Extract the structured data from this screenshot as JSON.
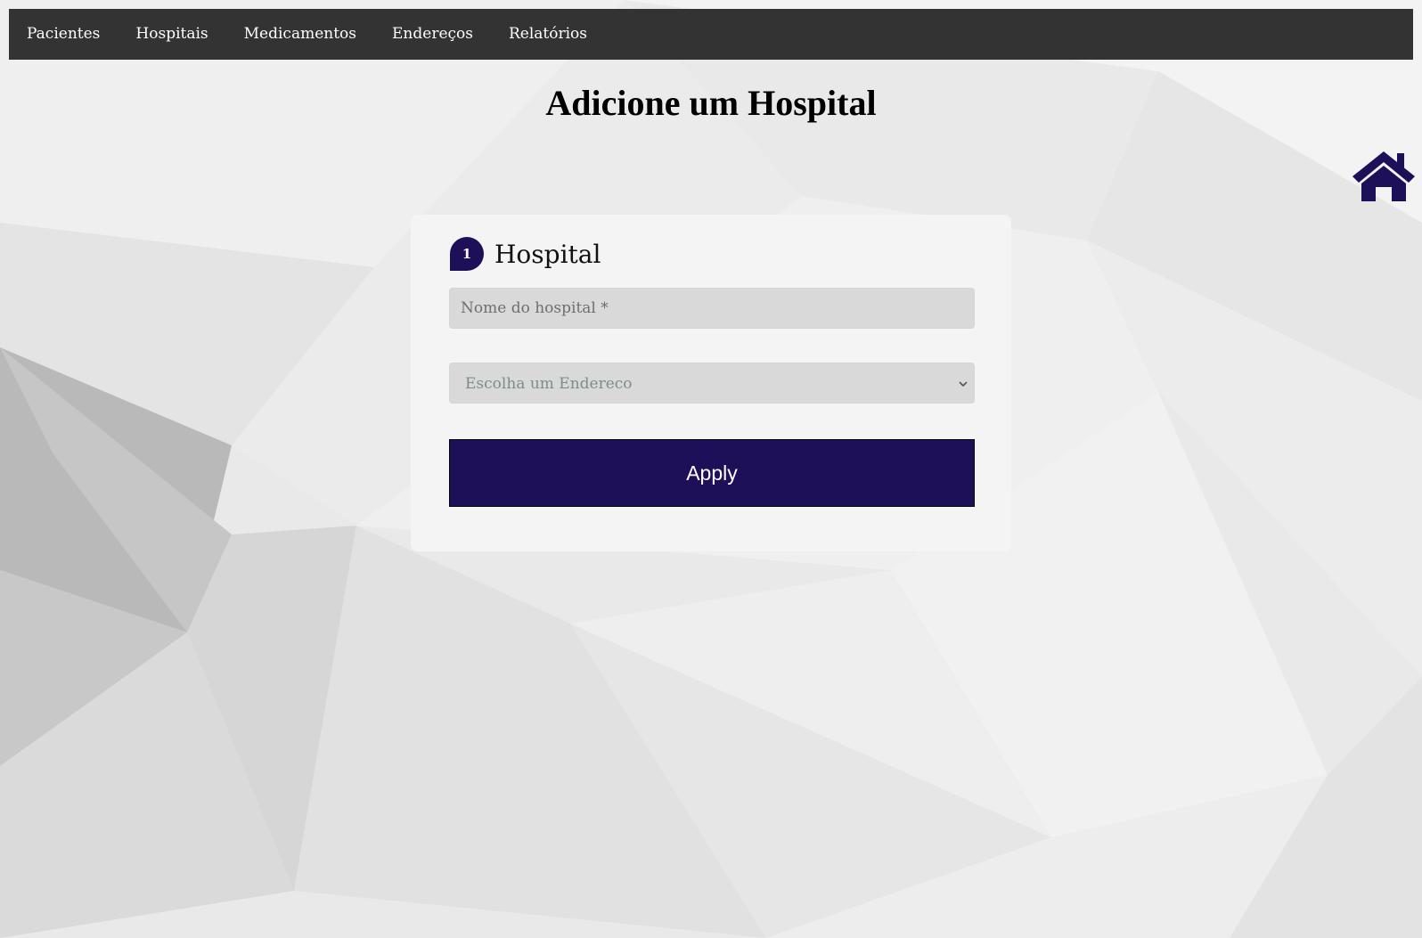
{
  "theme": {
    "accent": "#1e1058",
    "navbar_bg": "#333333",
    "nav_text": "#ffffff"
  },
  "navbar": {
    "items": [
      {
        "label": "Pacientes"
      },
      {
        "label": "Hospitais"
      },
      {
        "label": "Medicamentos"
      },
      {
        "label": "Endereços"
      },
      {
        "label": "Relatórios"
      }
    ]
  },
  "page": {
    "title": "Adicione um Hospital"
  },
  "home": {
    "icon": "home-icon"
  },
  "form": {
    "step_number": "1",
    "section_title": "Hospital",
    "name_field": {
      "placeholder": "Nome do hospital *",
      "value": ""
    },
    "address_select": {
      "selected": "Escolha um Endereco",
      "icon": "chevron-down-icon"
    },
    "apply_label": "Apply"
  }
}
